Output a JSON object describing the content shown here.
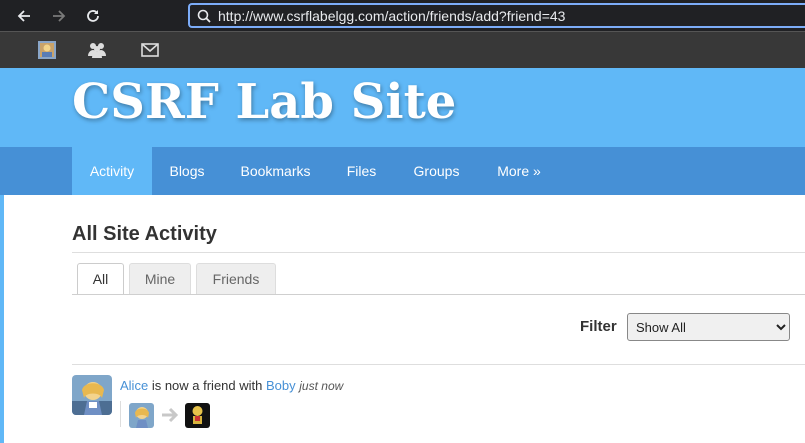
{
  "browser": {
    "url": "http://www.csrflabelgg.com/action/friends/add?friend=43"
  },
  "topbar": {
    "icons": [
      "avatar-icon",
      "friends-icon",
      "messages-icon"
    ]
  },
  "header": {
    "site_title": "CSRF Lab Site"
  },
  "menu": {
    "items": [
      {
        "label": "Activity",
        "active": true
      },
      {
        "label": "Blogs"
      },
      {
        "label": "Bookmarks"
      },
      {
        "label": "Files"
      },
      {
        "label": "Groups"
      },
      {
        "label": "More »"
      }
    ]
  },
  "main": {
    "title": "All Site Activity",
    "tabs": [
      {
        "label": "All",
        "active": true
      },
      {
        "label": "Mine"
      },
      {
        "label": "Friends"
      }
    ],
    "filter": {
      "label": "Filter",
      "selected": "Show All"
    },
    "activity": [
      {
        "subject": "Alice",
        "verb": "is now a friend with",
        "object": "Boby",
        "time": "just now"
      }
    ]
  },
  "colors": {
    "header_bg": "#60b8f7",
    "menu_bg": "#4690d6",
    "link": "#4690d6",
    "topbar_bg": "#383838"
  }
}
